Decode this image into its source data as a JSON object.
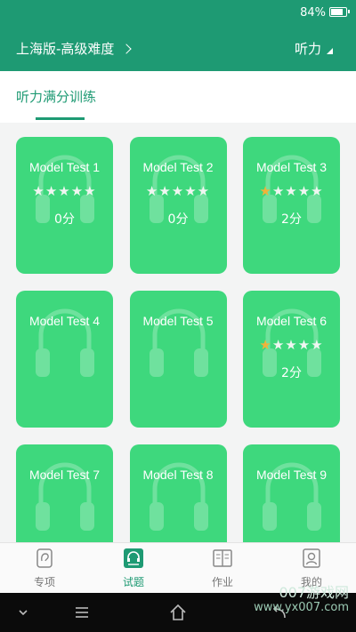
{
  "status_bar": {
    "battery_text": "84%",
    "battery_level": 0.84
  },
  "header": {
    "level_label": "上海版-高级难度",
    "subject_label": "听力"
  },
  "tabs": [
    {
      "label": "听力满分训练"
    }
  ],
  "tests": [
    {
      "title": "Model Test 1",
      "rating": 0,
      "score": "0分"
    },
    {
      "title": "Model Test 2",
      "rating": 0,
      "score": "0分"
    },
    {
      "title": "Model Test 3",
      "rating": 1,
      "score": "2分"
    },
    {
      "title": "Model Test 4",
      "rating": null,
      "score": ""
    },
    {
      "title": "Model Test 5",
      "rating": null,
      "score": ""
    },
    {
      "title": "Model Test 6",
      "rating": 1,
      "score": "2分"
    },
    {
      "title": "Model Test 7",
      "rating": null,
      "score": ""
    },
    {
      "title": "Model Test 8",
      "rating": null,
      "score": ""
    },
    {
      "title": "Model Test 9",
      "rating": null,
      "score": ""
    }
  ],
  "bottom_nav": [
    {
      "label": "专项",
      "icon": "ear-icon",
      "active": false
    },
    {
      "label": "试题",
      "icon": "headphones-list-icon",
      "active": true
    },
    {
      "label": "作业",
      "icon": "book-icon",
      "active": false
    },
    {
      "label": "我的",
      "icon": "user-icon",
      "active": false
    }
  ],
  "watermark": {
    "line1": "007游戏网",
    "line2": "www.yx007.com"
  },
  "colors": {
    "brand": "#1e9a73",
    "card": "#3ed87d",
    "star_on": "#f1b23a"
  }
}
